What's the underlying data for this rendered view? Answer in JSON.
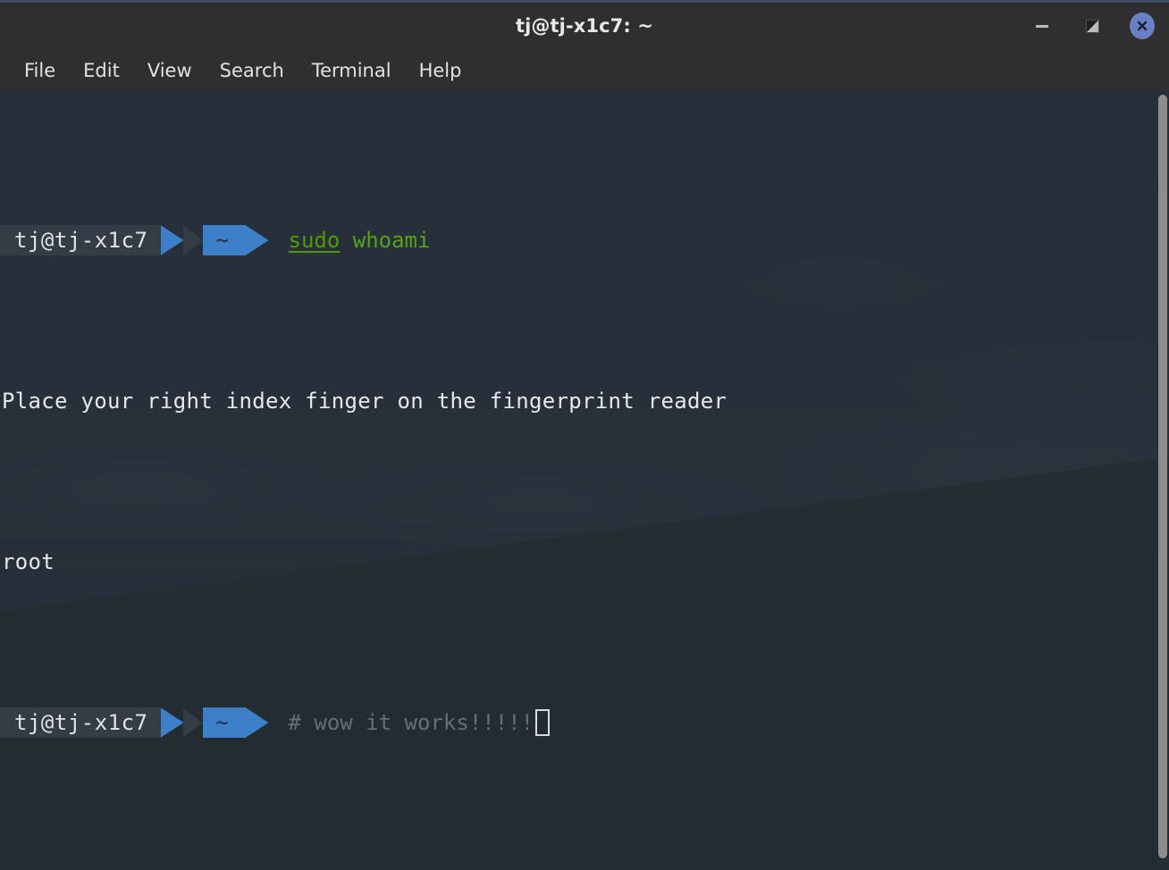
{
  "window": {
    "title": "tj@tj-x1c7: ~",
    "controls": {
      "minimize_label": "Minimize",
      "maximize_label": "Maximize",
      "close_label": "Close"
    },
    "accent_color": "#3d7fc8",
    "close_button_color": "#6a7fc4",
    "titlebar_color": "#2f2f2f"
  },
  "menubar": {
    "items": [
      {
        "label": "File"
      },
      {
        "label": "Edit"
      },
      {
        "label": "View"
      },
      {
        "label": "Search"
      },
      {
        "label": "Terminal"
      },
      {
        "label": "Help"
      }
    ]
  },
  "terminal": {
    "background_color": "#202933",
    "foreground_color": "#e6e9eb",
    "prompt": {
      "host_segment": "tj@tj-x1c7",
      "path_segment": "~",
      "host_bg": "#343d46",
      "path_bg": "#3d7fc8"
    },
    "lines": [
      {
        "type": "prompt",
        "command_tokens": [
          {
            "text": "sudo",
            "style": "sudo"
          },
          {
            "text": " ",
            "style": "plain"
          },
          {
            "text": "whoami",
            "style": "command"
          }
        ]
      },
      {
        "type": "output",
        "text": "Place your right index finger on the fingerprint reader"
      },
      {
        "type": "output",
        "text": "root"
      },
      {
        "type": "prompt",
        "command_tokens": [
          {
            "text": "# wow it works!!!!!",
            "style": "comment"
          }
        ],
        "cursor": true
      }
    ],
    "command_line_1": "sudo whoami",
    "output_line_1": "Place your right index finger on the fingerprint reader",
    "output_line_2": "root",
    "command_line_2": "# wow it works!!!!!"
  },
  "scrollbar": {
    "thumb_color": "#8d8d8d"
  }
}
